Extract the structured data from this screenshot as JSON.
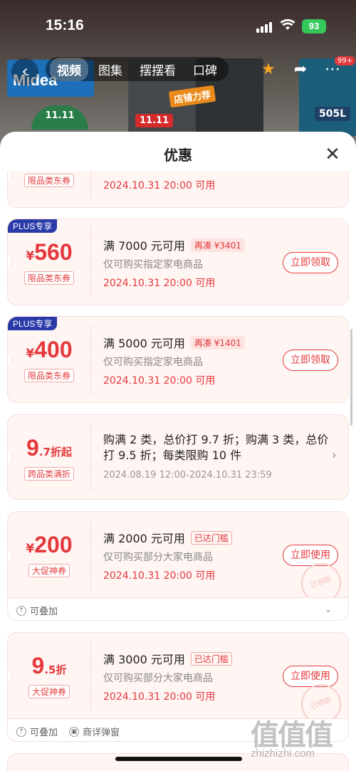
{
  "status_bar": {
    "time": "15:16",
    "battery": "93"
  },
  "header": {
    "tabs": [
      {
        "label": "视频",
        "active": true
      },
      {
        "label": "图集",
        "active": false
      },
      {
        "label": "摆摆看",
        "active": false
      },
      {
        "label": "口碑",
        "active": false
      }
    ],
    "message_badge": "99+"
  },
  "backdrop": {
    "brand": "Midea",
    "tag_1111": "11.11",
    "tag_rec": "店铺力荐",
    "tag_capacity": "505L",
    "tag_green": "11.11"
  },
  "sheet": {
    "title": "优惠"
  },
  "coupons": [
    {
      "type_label": "限品类东券",
      "date": "2024.10.31 20:00 可用"
    },
    {
      "plus": "PLUS专享",
      "currency": "¥",
      "amount": "560",
      "type_label": "限品类东券",
      "title": "满 7000 元可用",
      "tag": "再凑 ¥3401",
      "desc": "仅可购买指定家电商品",
      "date": "2024.10.31 20:00 可用",
      "button": "立即领取"
    },
    {
      "plus": "PLUS专享",
      "currency": "¥",
      "amount": "400",
      "type_label": "限品类东券",
      "title": "满 5000 元可用",
      "tag": "再凑 ¥1401",
      "desc": "仅可购买指定家电商品",
      "date": "2024.10.31 20:00 可用",
      "button": "立即领取"
    },
    {
      "amount_big": "9",
      "amount_small": ".7折起",
      "type_label": "跨品类满折",
      "text": "购满 2 类，总价打 9.7 折；购满 3 类，总价打 9.5 折；每类限购 10 件",
      "date": "2024.08.19 12:00-2024.10.31 23:59"
    },
    {
      "currency": "¥",
      "amount": "200",
      "type_label": "大促神券",
      "title": "满 2000 元可用",
      "tag": "已达门槛",
      "desc": "仅可购买部分大家电商品",
      "date": "2024.10.31 20:00 可用",
      "button": "立即使用",
      "stamp": "已领取",
      "footer": [
        "可叠加"
      ]
    },
    {
      "amount_big": "9",
      "amount_small": ".5折",
      "type_label": "大促神券",
      "title": "满 3000 元可用",
      "tag": "已达门槛",
      "desc": "仅可购买部分大家电商品",
      "date": "2024.10.31 20:00 可用",
      "button": "立即使用",
      "stamp": "已领取",
      "footer": [
        "可叠加",
        "商详弹窗"
      ]
    }
  ],
  "watermark": {
    "logo": "值值值",
    "site": "zhizhizhi.com"
  }
}
